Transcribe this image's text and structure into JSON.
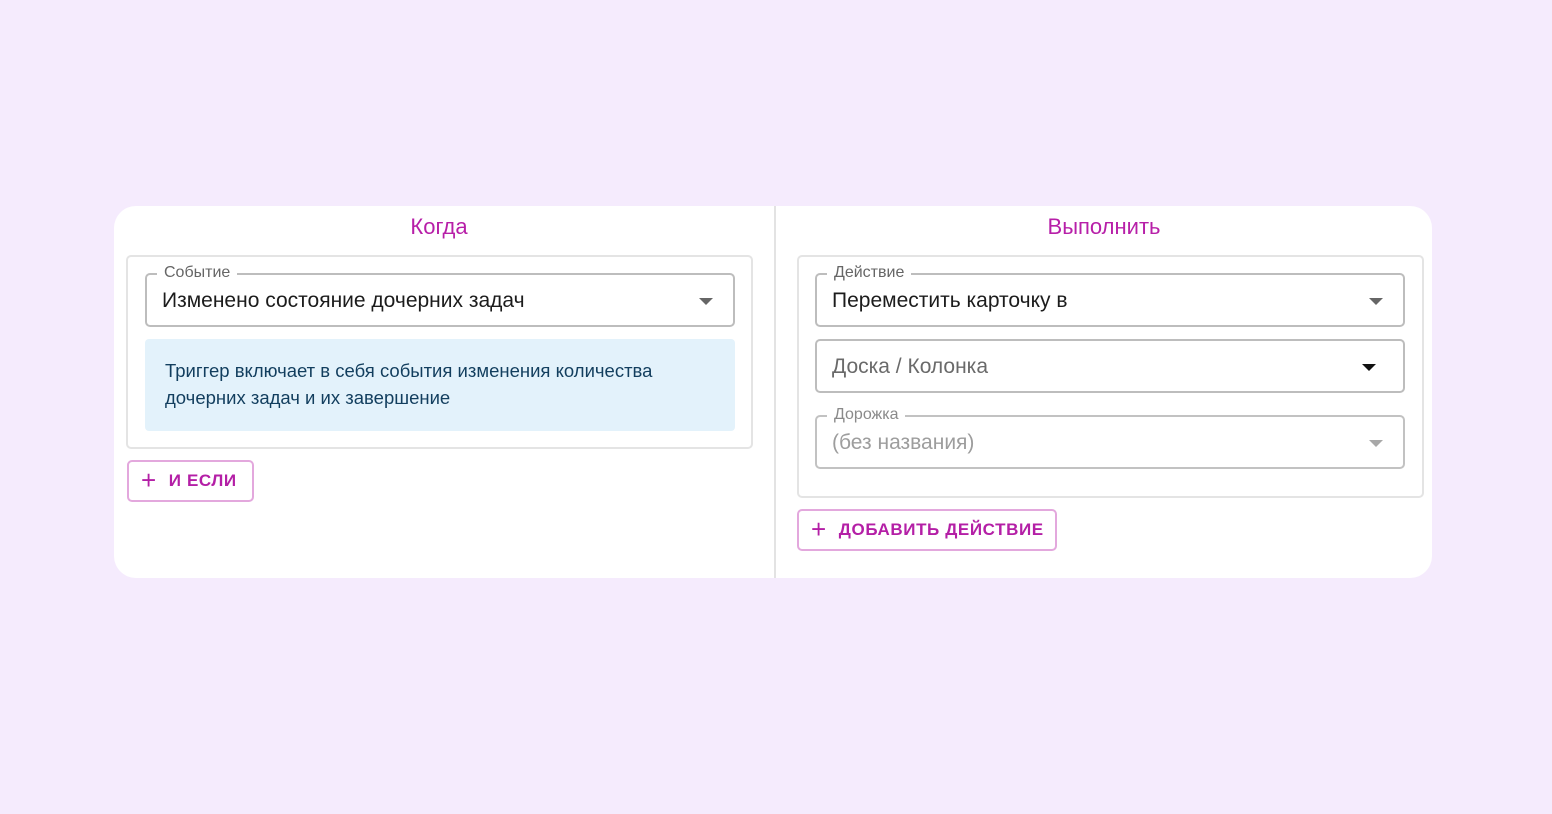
{
  "when": {
    "title": "Когда",
    "event": {
      "label": "Событие",
      "value": "Изменено состояние дочерних задач"
    },
    "info": "Триггер включает в себя события изменения количества дочерних задач и их завершение",
    "and_if_button": "И ЕСЛИ"
  },
  "execute": {
    "title": "Выполнить",
    "action": {
      "label": "Действие",
      "value": "Переместить карточку в"
    },
    "board_column": {
      "placeholder": "Доска / Колонка"
    },
    "lane": {
      "label": "Дорожка",
      "value": "(без названия)"
    },
    "add_action_button": "ДОБАВИТЬ ДЕЙСТВИЕ"
  },
  "icons": {
    "plus": "+",
    "dropdown": "arrow-drop-down-icon"
  },
  "colors": {
    "background": "#f5ebfd",
    "accent": "#b71fa8",
    "info_bg": "#e3f2fb",
    "info_text": "#123e5e"
  }
}
